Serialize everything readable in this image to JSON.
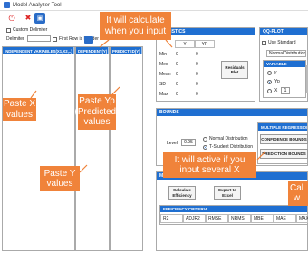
{
  "window": {
    "title": "Model Analyzer Tool"
  },
  "toolbar": {
    "custom_delimiter": "Custom Delimiter",
    "delimiter": "Delimiter",
    "first_row_header": "First Row is Header"
  },
  "columns": {
    "independent": "INDEPENDENT VARIABLES(X1,X2,..)",
    "dependent": "DEPENDENT(Y)",
    "predicted": "PREDICTED(Y)"
  },
  "stats": {
    "header": "STATISTICS",
    "cols": [
      "Y",
      "YP"
    ],
    "rows": [
      {
        "label": "Min",
        "y": "0",
        "yp": "0"
      },
      {
        "label": "Med",
        "y": "0",
        "yp": "0"
      },
      {
        "label": "Mean",
        "y": "0",
        "yp": "0"
      },
      {
        "label": "SD",
        "y": "0",
        "yp": "0"
      },
      {
        "label": "Max",
        "y": "0",
        "yp": "0"
      }
    ],
    "residuals_plot": "Residuals Plot"
  },
  "qqplot": {
    "header": "QQ-PLOT",
    "use_standard": "Use Standard",
    "normal_distribution": "NormalDistribution",
    "variable_label": "VARIABLE",
    "options": [
      "y",
      "Yp",
      "X"
    ],
    "x_index": "1"
  },
  "bounds": {
    "header": "BOUNDS",
    "level_label": "Level",
    "level_value": "0.95",
    "normal": "Normal Distribution",
    "tstudent": "T-Student Distribution"
  },
  "multiple_regression": {
    "header": "MULTIPLE REGRESSION",
    "confidence": "CONFIDENCE BOUNDS",
    "prediction": "PREDICTION BOUNDS"
  },
  "metrics": {
    "header": "MO",
    "calculate": "Calculate Efficiency",
    "export": "Export to Excel"
  },
  "efficiency": {
    "header": "EFFICIENCY CRITERIA",
    "cols": [
      "R2",
      "ADJR2",
      "RMSE",
      "NRMS",
      "MBE",
      "MAE",
      "MAX"
    ]
  },
  "annotations": {
    "calc": "It will calculate\nwhen you input",
    "paste_x": "Paste X\nvalues",
    "paste_yp": "Paste Yp\n(Predicted)\nvalues",
    "paste_y": "Paste Y\nvalues",
    "active": "It will active if you\ninput several X",
    "cal_partial": "Cal\nw"
  },
  "colors": {
    "accent": "#1f6fd1",
    "annotation": "#f0833a"
  }
}
